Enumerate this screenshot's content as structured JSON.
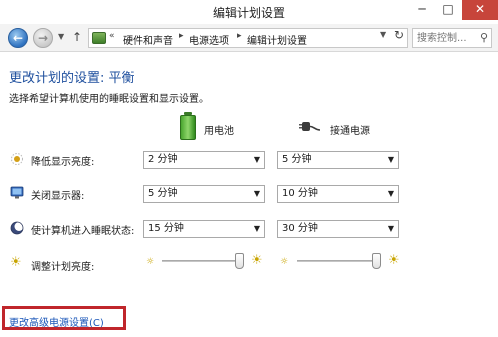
{
  "window": {
    "title": "编辑计划设置",
    "min_symbol": "─",
    "max_symbol": "□",
    "close_symbol": "✕"
  },
  "nav": {
    "back_symbol": "←",
    "forward_symbol": "→",
    "up_symbol": "↑",
    "refresh_symbol": "↻",
    "breadcrumbs": [
      "硬件和声音",
      "电源选项",
      "编辑计划设置"
    ],
    "search_placeholder": "搜索控制...",
    "search_icon": "search-icon"
  },
  "page": {
    "heading": "更改计划的设置: 平衡",
    "subtitle": "选择希望计算机使用的睡眠设置和显示设置。"
  },
  "columns": {
    "battery": "用电池",
    "plugged": "接通电源"
  },
  "settings": [
    {
      "label": "降低显示亮度:",
      "icon": "dim-display-icon",
      "battery": "2 分钟",
      "plugged": "5 分钟"
    },
    {
      "label": "关闭显示器:",
      "icon": "monitor-icon",
      "battery": "5 分钟",
      "plugged": "10 分钟"
    },
    {
      "label": "使计算机进入睡眠状态:",
      "icon": "sleep-moon-icon",
      "battery": "15 分钟",
      "plugged": "30 分钟"
    }
  ],
  "brightness": {
    "label": "调整计划亮度:",
    "icon": "brightness-icon",
    "battery_level": 1.0,
    "plugged_level": 1.0
  },
  "link": {
    "label": "更改高级电源设置(C)"
  },
  "colors": {
    "heading": "#1e4f9e",
    "link": "#1a56b8",
    "highlight_box": "#c0262b",
    "close_button": "#c7453b"
  }
}
